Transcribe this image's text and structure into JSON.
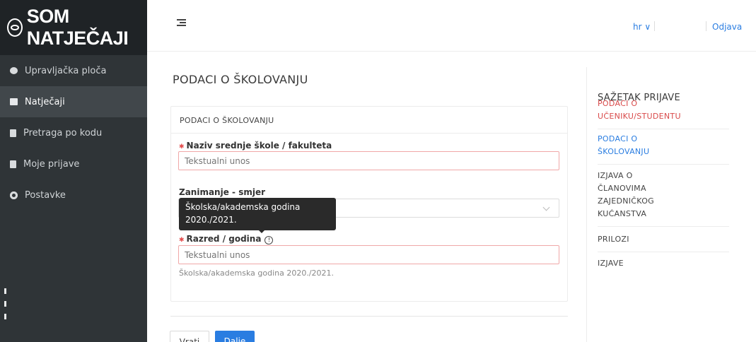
{
  "brand": {
    "title": "SOM NATJEČAJI"
  },
  "sidebar": {
    "items": [
      {
        "label": "Upravljačka ploča",
        "icon": "pie-chart-icon"
      },
      {
        "label": "Natječaji",
        "icon": "folder-icon"
      },
      {
        "label": "Pretraga po kodu",
        "icon": "document-icon"
      },
      {
        "label": "Moje prijave",
        "icon": "document-icon"
      },
      {
        "label": "Postavke",
        "icon": "gear-icon"
      }
    ],
    "active_index": 1
  },
  "topbar": {
    "language": "hr ∨",
    "logout": "Odjava"
  },
  "main": {
    "page_title": "PODACI O ŠKOLOVANJU",
    "card_header": "PODACI O ŠKOLOVANJU",
    "fields": {
      "school": {
        "label": "Naziv srednje škole / fakulteta",
        "placeholder": "Tekstualni unos",
        "required": true
      },
      "occupation": {
        "label": "Zanimanje - smjer",
        "value": ""
      },
      "grade": {
        "label": "Razred / godina",
        "placeholder": "Tekstualni unos",
        "required": true,
        "help": "Školska/akademska godina 2020./2021."
      }
    },
    "tooltip": {
      "line1": "Školska/akademska godina",
      "line2": "2020./2021."
    },
    "buttons": {
      "back": "Vrati",
      "next": "Dalje"
    }
  },
  "summary": {
    "title": "SAŽETAK PRIJAVE",
    "items": [
      {
        "lines": [
          "PODACI O",
          "UČENIKU/STUDENTU"
        ],
        "color": "#d94a4a"
      },
      {
        "lines": [
          "PODACI O",
          "ŠKOLOVANJU"
        ],
        "color": "#2a7de1"
      },
      {
        "lines": [
          "IZJAVA O",
          "ČLANOVIMA",
          "ZAJEDNIČKOG",
          "KUĆANSTVA"
        ],
        "color": "#444444"
      },
      {
        "lines": [
          "PRILOZI"
        ],
        "color": "#444444"
      },
      {
        "lines": [
          "IZJAVE"
        ],
        "color": "#444444"
      }
    ]
  },
  "colors": {
    "accent": "#2a7de1",
    "sidebar": "#2f3437",
    "error": "#e44d4d"
  }
}
